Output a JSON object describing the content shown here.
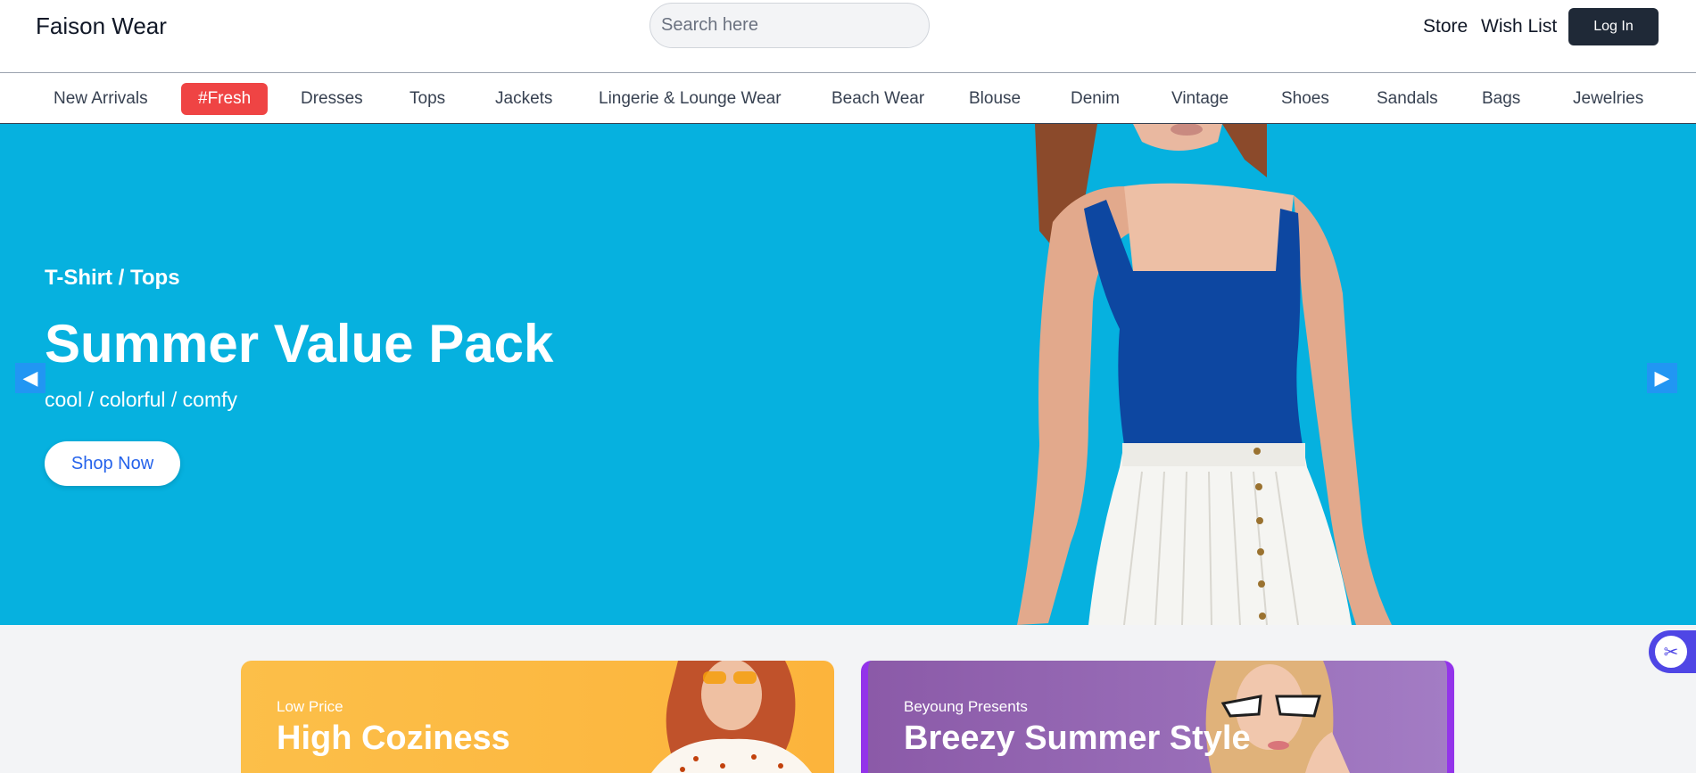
{
  "header": {
    "brand": "Faison Wear",
    "search_placeholder": "Search here",
    "store_label": "Store",
    "wishlist_label": "Wish List",
    "login_label": "Log In"
  },
  "categories": [
    "New Arrivals",
    "#Fresh",
    "Dresses",
    "Tops",
    "Jackets",
    "Lingerie & Lounge Wear",
    "Beach Wear",
    "Blouse",
    "Denim",
    "Vintage",
    "Shoes",
    "Sandals",
    "Bags",
    "Jewelries"
  ],
  "hero": {
    "kicker": "T-Shirt / Tops",
    "title": "Summer Value Pack",
    "subtitle": "cool / colorful / comfy",
    "cta": "Shop Now",
    "prev_icon": "left-arrow-icon",
    "next_icon": "right-arrow-icon",
    "background": "#06b1df"
  },
  "promos": [
    {
      "kicker": "Low Price",
      "title": "High Coziness"
    },
    {
      "kicker": "Beyoung Presents",
      "title": "Breezy Summer Style"
    }
  ],
  "floating": {
    "icon": "scissors-icon"
  },
  "colors": {
    "accent_red": "#ef4444",
    "login_bg": "#1f2937",
    "cta_text": "#2563eb"
  }
}
